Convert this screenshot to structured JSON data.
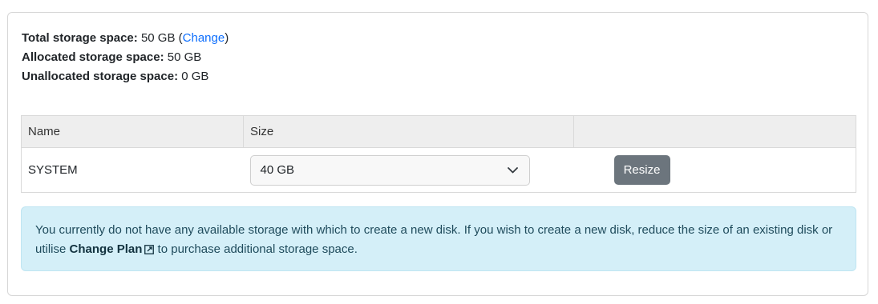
{
  "summary": {
    "total_label": "Total storage space:",
    "total_value": "50 GB",
    "change_open": "(",
    "change_link": "Change",
    "change_close": ")",
    "allocated_label": "Allocated storage space:",
    "allocated_value": "50 GB",
    "unallocated_label": "Unallocated storage space:",
    "unallocated_value": "0 GB"
  },
  "table": {
    "headers": [
      "Name",
      "Size",
      ""
    ],
    "rows": [
      {
        "name": "SYSTEM",
        "size": "40 GB",
        "action": "Resize"
      }
    ]
  },
  "alert": {
    "text_before": "You currently do not have any available storage with which to create a new disk. If you wish to create a new disk, reduce the size of an existing disk or utilise ",
    "link": "Change Plan",
    "text_after": " to purchase additional storage space."
  },
  "icons": {
    "select_arrow": "chevron-down-icon",
    "external_link": "external-link-icon"
  },
  "colors": {
    "link": "#0d6efd",
    "button": "#6c757d",
    "alert_bg": "#d4eff8"
  }
}
